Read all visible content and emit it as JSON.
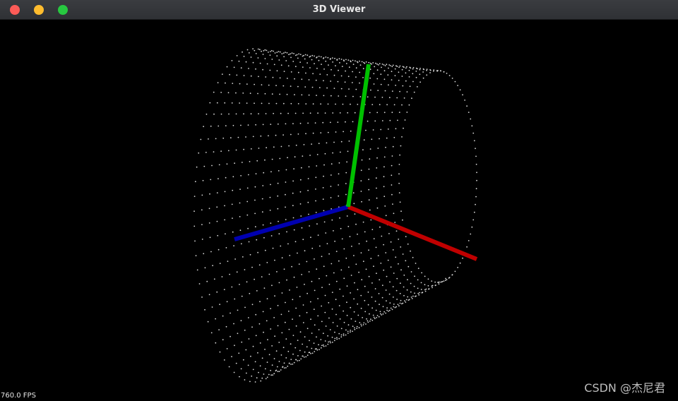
{
  "window": {
    "title": "3D Viewer"
  },
  "viewport": {
    "fps_label": "760.0 FPS",
    "watermark": "CSDN @杰尼君",
    "colors": {
      "background": "#000000",
      "points": "#d8d8d8",
      "axis_x": "#c00000",
      "axis_y": "#00c000",
      "axis_z": "#0000b0"
    },
    "point_cloud": {
      "shape": "cylinder",
      "columns": 28,
      "rows": 42
    },
    "axes": [
      {
        "name": "x",
        "color_key": "axis_x"
      },
      {
        "name": "y",
        "color_key": "axis_y"
      },
      {
        "name": "z",
        "color_key": "axis_z"
      }
    ]
  },
  "controls": {
    "close_icon": "close-dot-icon",
    "minimize_icon": "minimize-dot-icon",
    "maximize_icon": "maximize-dot-icon"
  }
}
